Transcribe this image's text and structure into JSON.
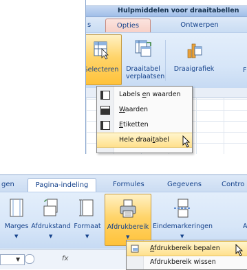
{
  "top": {
    "contextual_title": "Hulpmiddelen voor draaitabellen",
    "tabs": {
      "partial_left": "s",
      "opties": "Opties",
      "ontwerpen": "Ontwerpen"
    },
    "ribbon": {
      "selecteren": "Selecteren",
      "draaitabel_line1": "Draaitabel",
      "draaitabel_line2": "verplaatsen",
      "draaigrafiek": "Draaigrafiek",
      "partial_right": "F"
    },
    "menu": {
      "items": [
        {
          "pre": "Labels ",
          "ul": "e",
          "post": "n waarden"
        },
        {
          "pre": "",
          "ul": "W",
          "post": "aarden"
        },
        {
          "pre": "",
          "ul": "E",
          "post": "tiketten"
        },
        {
          "pre": "Hele draai",
          "ul": "t",
          "post": "abel"
        }
      ],
      "highlighted_index": 3
    }
  },
  "bottom": {
    "tabs": {
      "partial_left": "gen",
      "pagina_indeling": "Pagina-indeling",
      "formules": "Formules",
      "gegevens": "Gegevens",
      "partial_right": "Contro"
    },
    "ribbon": {
      "marges": "Marges",
      "afdrukstand": "Afdrukstand",
      "formaat": "Formaat",
      "afdrukbereik": "Afdrukbereik",
      "eindemarkeringen": "Eindemarkeringen",
      "partial_right": "A"
    },
    "formula_bar": {
      "fx": "fx"
    },
    "menu": {
      "items": [
        {
          "pre": "",
          "ul": "A",
          "post": "fdrukbereik bepalen"
        },
        {
          "pre": "Afdrukbereik wissen",
          "ul": "",
          "post": ""
        }
      ],
      "highlighted_index": 0
    }
  }
}
